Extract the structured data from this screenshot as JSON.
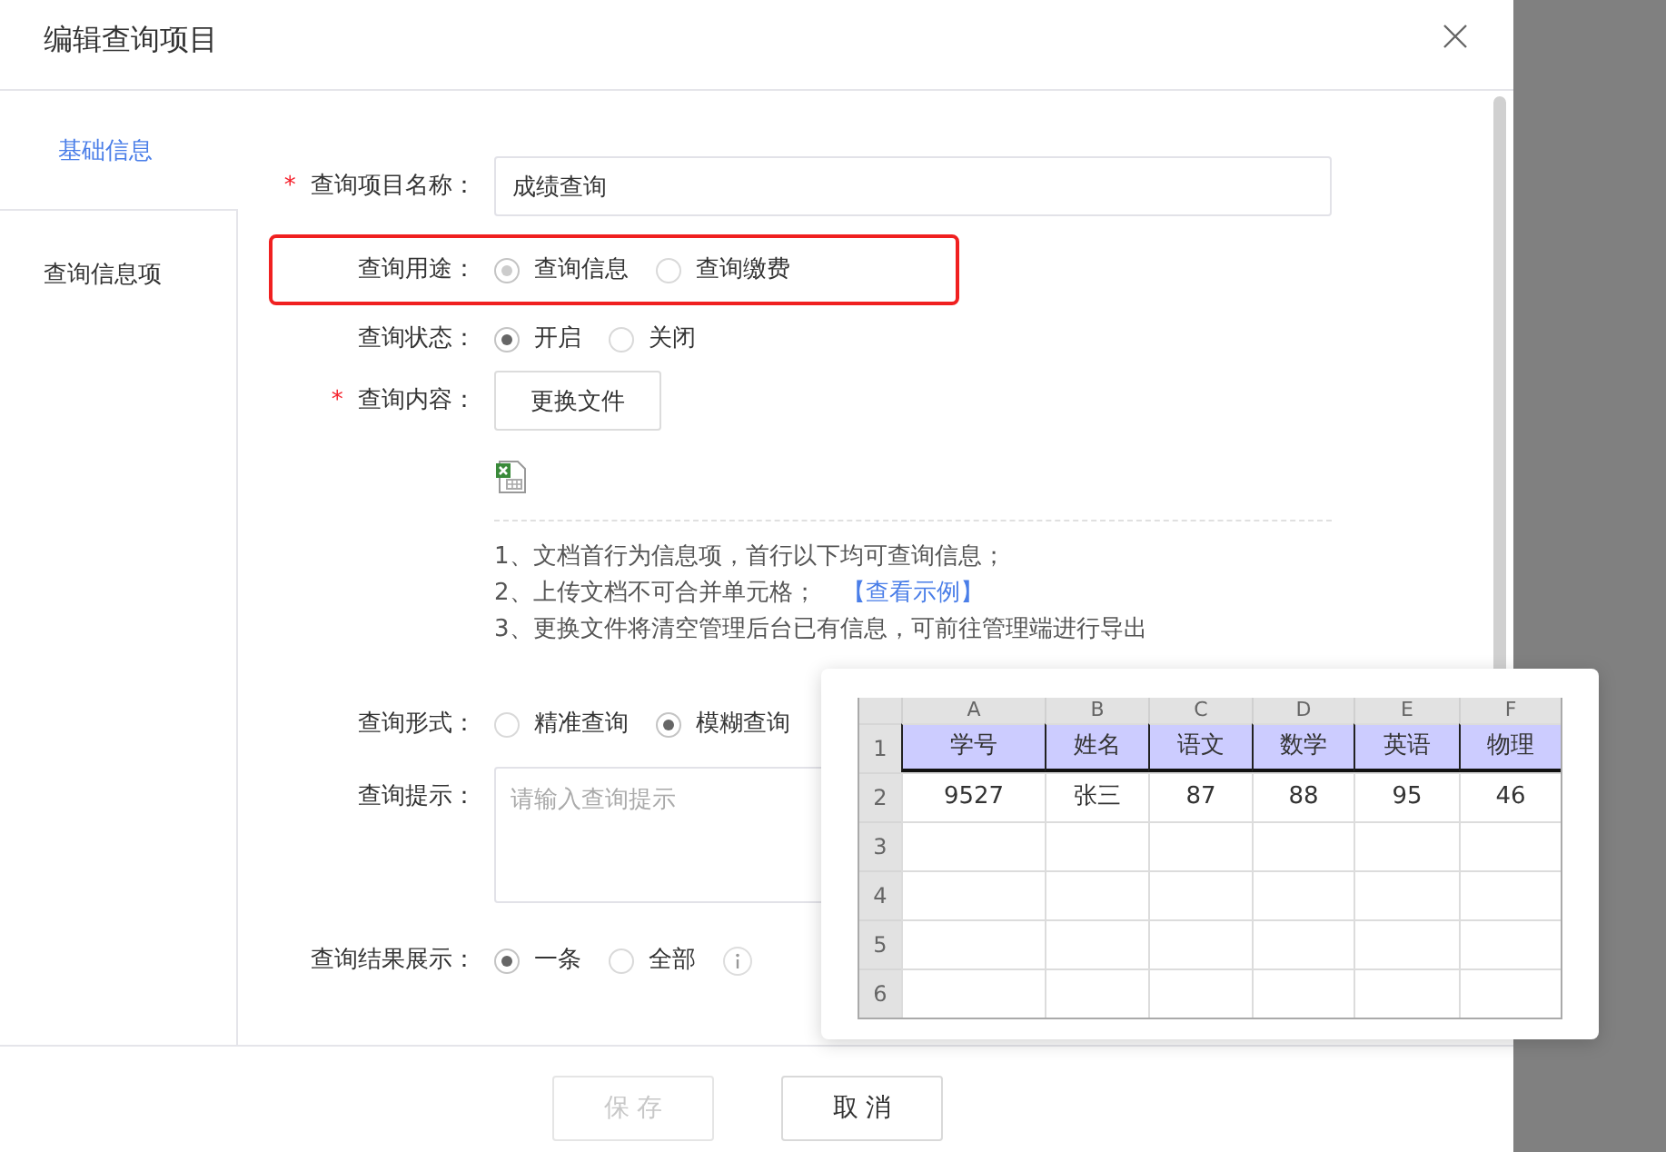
{
  "dialog": {
    "title": "编辑查询项目"
  },
  "nav": [
    {
      "label": "基础信息",
      "selected": true
    },
    {
      "label": "查询信息项",
      "selected": false
    }
  ],
  "fields": [
    {
      "kind": "text",
      "label": "查询项目名称：",
      "required_mark": "*",
      "value": "成绩查询"
    },
    {
      "kind": "radio",
      "label": "查询用途：",
      "highlighted": true,
      "disabled": true,
      "options": [
        {
          "label": "查询信息",
          "selected": true
        },
        {
          "label": "查询缴费",
          "selected": false
        }
      ]
    },
    {
      "kind": "radio",
      "label": "查询状态：",
      "options": [
        {
          "label": "开启",
          "selected": true
        },
        {
          "label": "关闭",
          "selected": false
        }
      ]
    },
    {
      "kind": "file",
      "label": "查询内容：",
      "required_mark": "*",
      "button": "更换文件",
      "notes": [
        {
          "text": "1、文档首行为信息项，首行以下均可查询信息；"
        },
        {
          "text": "2、上传文档不可合并单元格；",
          "link": "【查看示例】"
        },
        {
          "text": "3、更换文件将清空管理后台已有信息，可前往管理端进行导出"
        }
      ]
    },
    {
      "kind": "radio",
      "label": "查询形式：",
      "options": [
        {
          "label": "精准查询",
          "selected": false
        },
        {
          "label": "模糊查询",
          "selected": true
        }
      ]
    },
    {
      "kind": "textarea",
      "label": "查询提示：",
      "placeholder": "请输入查询提示"
    },
    {
      "kind": "radio",
      "label": "查询结果展示：",
      "info_icon": true,
      "options": [
        {
          "label": "一条",
          "selected": true
        },
        {
          "label": "全部",
          "selected": false
        }
      ]
    }
  ],
  "footer_buttons": [
    {
      "label": "保 存",
      "disabled": true
    },
    {
      "label": "取 消",
      "disabled": false
    }
  ],
  "example_popup": {
    "columns": [
      "A",
      "B",
      "C",
      "D",
      "E",
      "F"
    ],
    "rows": [
      {
        "number": "1",
        "highlighted": true,
        "cells": [
          "学号",
          "姓名",
          "语文",
          "数学",
          "英语",
          "物理"
        ]
      },
      {
        "number": "2",
        "highlighted": false,
        "cells": [
          "9527",
          "张三",
          "87",
          "88",
          "95",
          "46"
        ]
      },
      {
        "number": "3",
        "highlighted": false,
        "cells": []
      },
      {
        "number": "4",
        "highlighted": false,
        "cells": []
      },
      {
        "number": "5",
        "highlighted": false,
        "cells": []
      },
      {
        "number": "6",
        "highlighted": false,
        "cells": []
      }
    ]
  }
}
